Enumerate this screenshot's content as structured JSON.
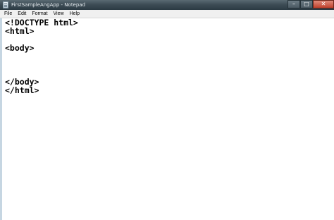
{
  "window": {
    "title": "FirstSampleAngApp - Notepad",
    "controls": {
      "minimize_glyph": "–",
      "maximize_glyph": "□",
      "close_glyph": "✕"
    }
  },
  "menu": {
    "items": [
      {
        "label": "File"
      },
      {
        "label": "Edit"
      },
      {
        "label": "Format"
      },
      {
        "label": "View"
      },
      {
        "label": "Help"
      }
    ]
  },
  "editor": {
    "content": "<!DOCTYPE html>\n<html>\n\n<body>\n\n\n\n</body>\n</html>"
  }
}
